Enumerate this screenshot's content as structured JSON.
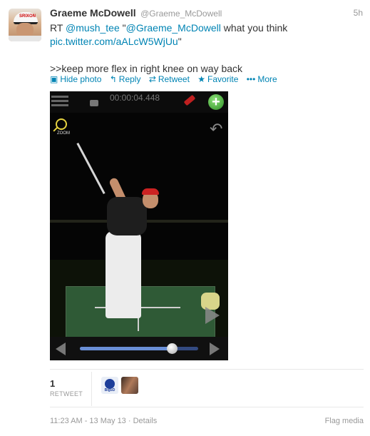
{
  "tweet": {
    "author": {
      "name": "Graeme McDowell",
      "handle": "@Graeme_McDowell",
      "avatar_cap_text": "SRIXON"
    },
    "time": "5h",
    "text": {
      "prefix": "RT ",
      "mention1": "@mush_tee",
      "quote_open": " \"",
      "mention2": "@Graeme_McDowell",
      "rest": " what you think",
      "link": "pic.twitter.com/aALcW5WjUu",
      "link_close": "\"",
      "comment": ">>keep more flex in right knee on way back"
    },
    "actions": [
      {
        "icon": "media-icon",
        "glyph": "▣",
        "label": "Hide photo"
      },
      {
        "icon": "reply-icon",
        "glyph": "↰",
        "label": "Reply"
      },
      {
        "icon": "retweet-icon",
        "glyph": "⇄",
        "label": "Retweet"
      },
      {
        "icon": "star-icon",
        "glyph": "★",
        "label": "Favorite"
      },
      {
        "icon": "more-icon",
        "glyph": "•••",
        "label": "More"
      }
    ],
    "media": {
      "timer": "00:00:04.448",
      "zoom_label": "ZOOM",
      "playback_position": 0.78
    },
    "stats": {
      "retweet_count": "1",
      "retweet_label": "RETWEET"
    },
    "retweeter_badge": "BiguD",
    "footer": {
      "timestamp": "11:23 AM - 13 May 13",
      "separator": " · ",
      "details": "Details",
      "flag": "Flag media"
    }
  },
  "colors": {
    "link": "#0084b4",
    "muted": "#999999",
    "text": "#333333"
  }
}
